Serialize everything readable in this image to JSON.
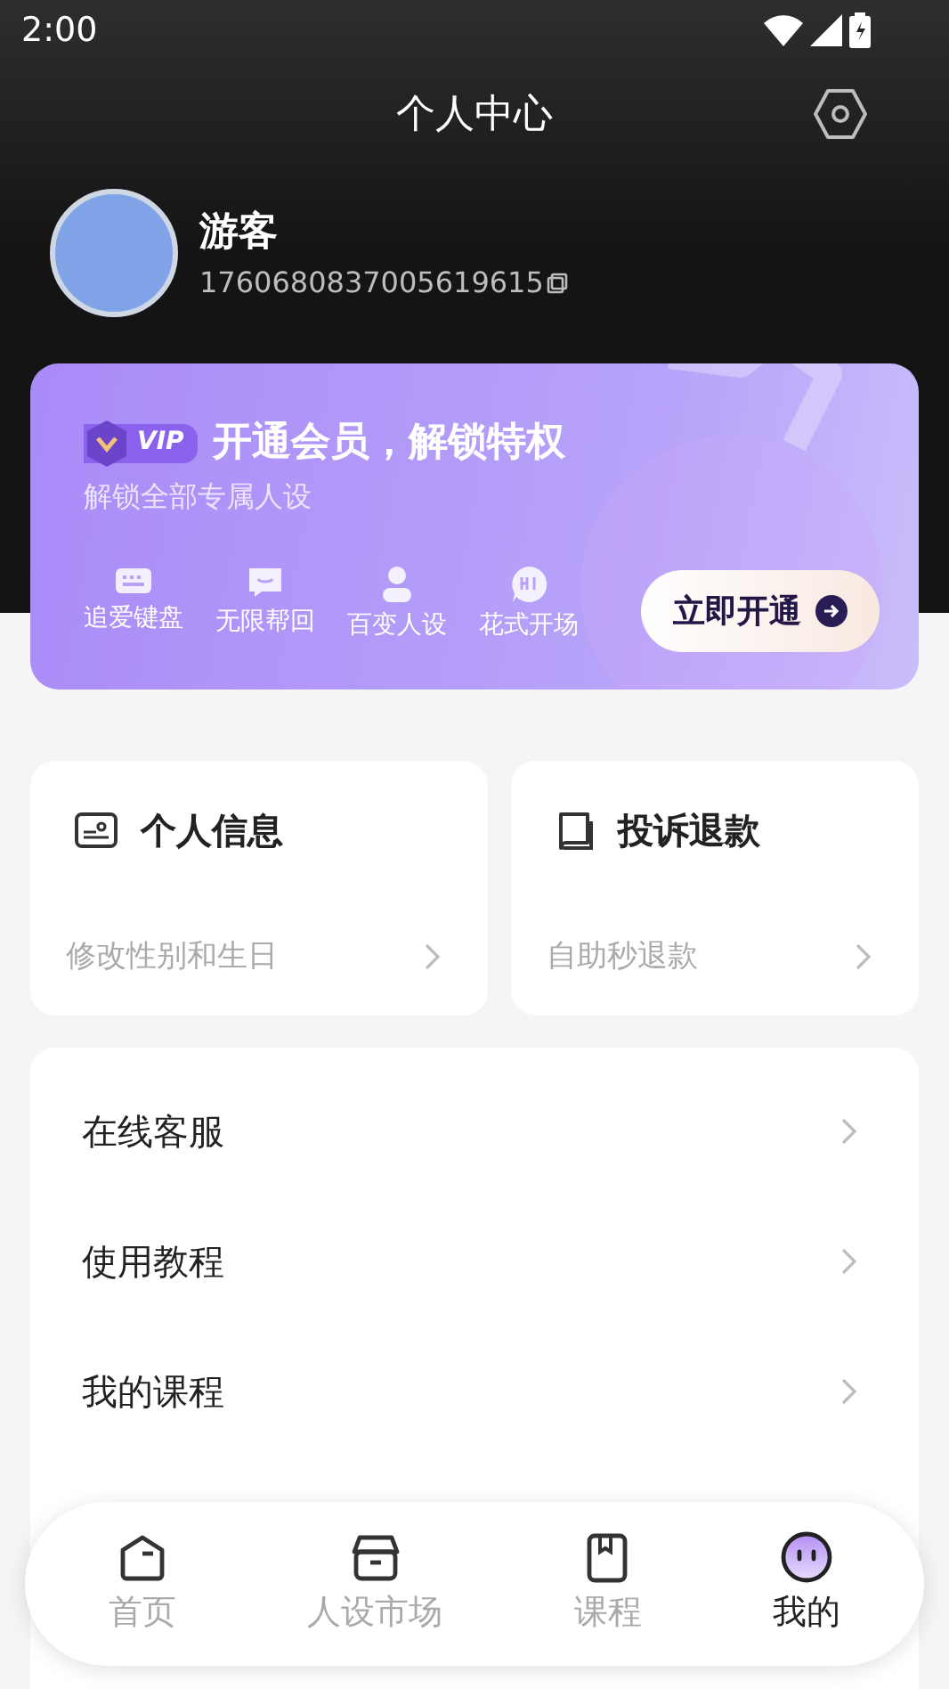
{
  "status_bar": {
    "time": "2:00"
  },
  "header": {
    "title": "个人中心"
  },
  "profile": {
    "name": "游客",
    "id": "1760680837005619615"
  },
  "vip": {
    "title": "开通会员，解锁特权",
    "subtitle": "解锁全部专属人设",
    "badge": "VIP",
    "button": "立即开通",
    "perks": [
      {
        "kind": "keyboard",
        "label": "追爱键盘"
      },
      {
        "kind": "chat",
        "label": "无限帮回"
      },
      {
        "kind": "person",
        "label": "百变人设"
      },
      {
        "kind": "hi",
        "label": "花式开场"
      }
    ]
  },
  "cards": [
    {
      "kind": "id-card",
      "title": "个人信息",
      "subtitle": "修改性别和生日"
    },
    {
      "kind": "book",
      "title": "投诉退款",
      "subtitle": "自助秒退款"
    }
  ],
  "menu": [
    {
      "label": "在线客服"
    },
    {
      "label": "使用教程"
    },
    {
      "label": "我的课程"
    }
  ],
  "tabs": [
    {
      "kind": "home",
      "label": "首页",
      "selected": false
    },
    {
      "kind": "market",
      "label": "人设市场",
      "selected": false
    },
    {
      "kind": "course",
      "label": "课程",
      "selected": false
    },
    {
      "kind": "me",
      "label": "我的",
      "selected": true
    }
  ]
}
